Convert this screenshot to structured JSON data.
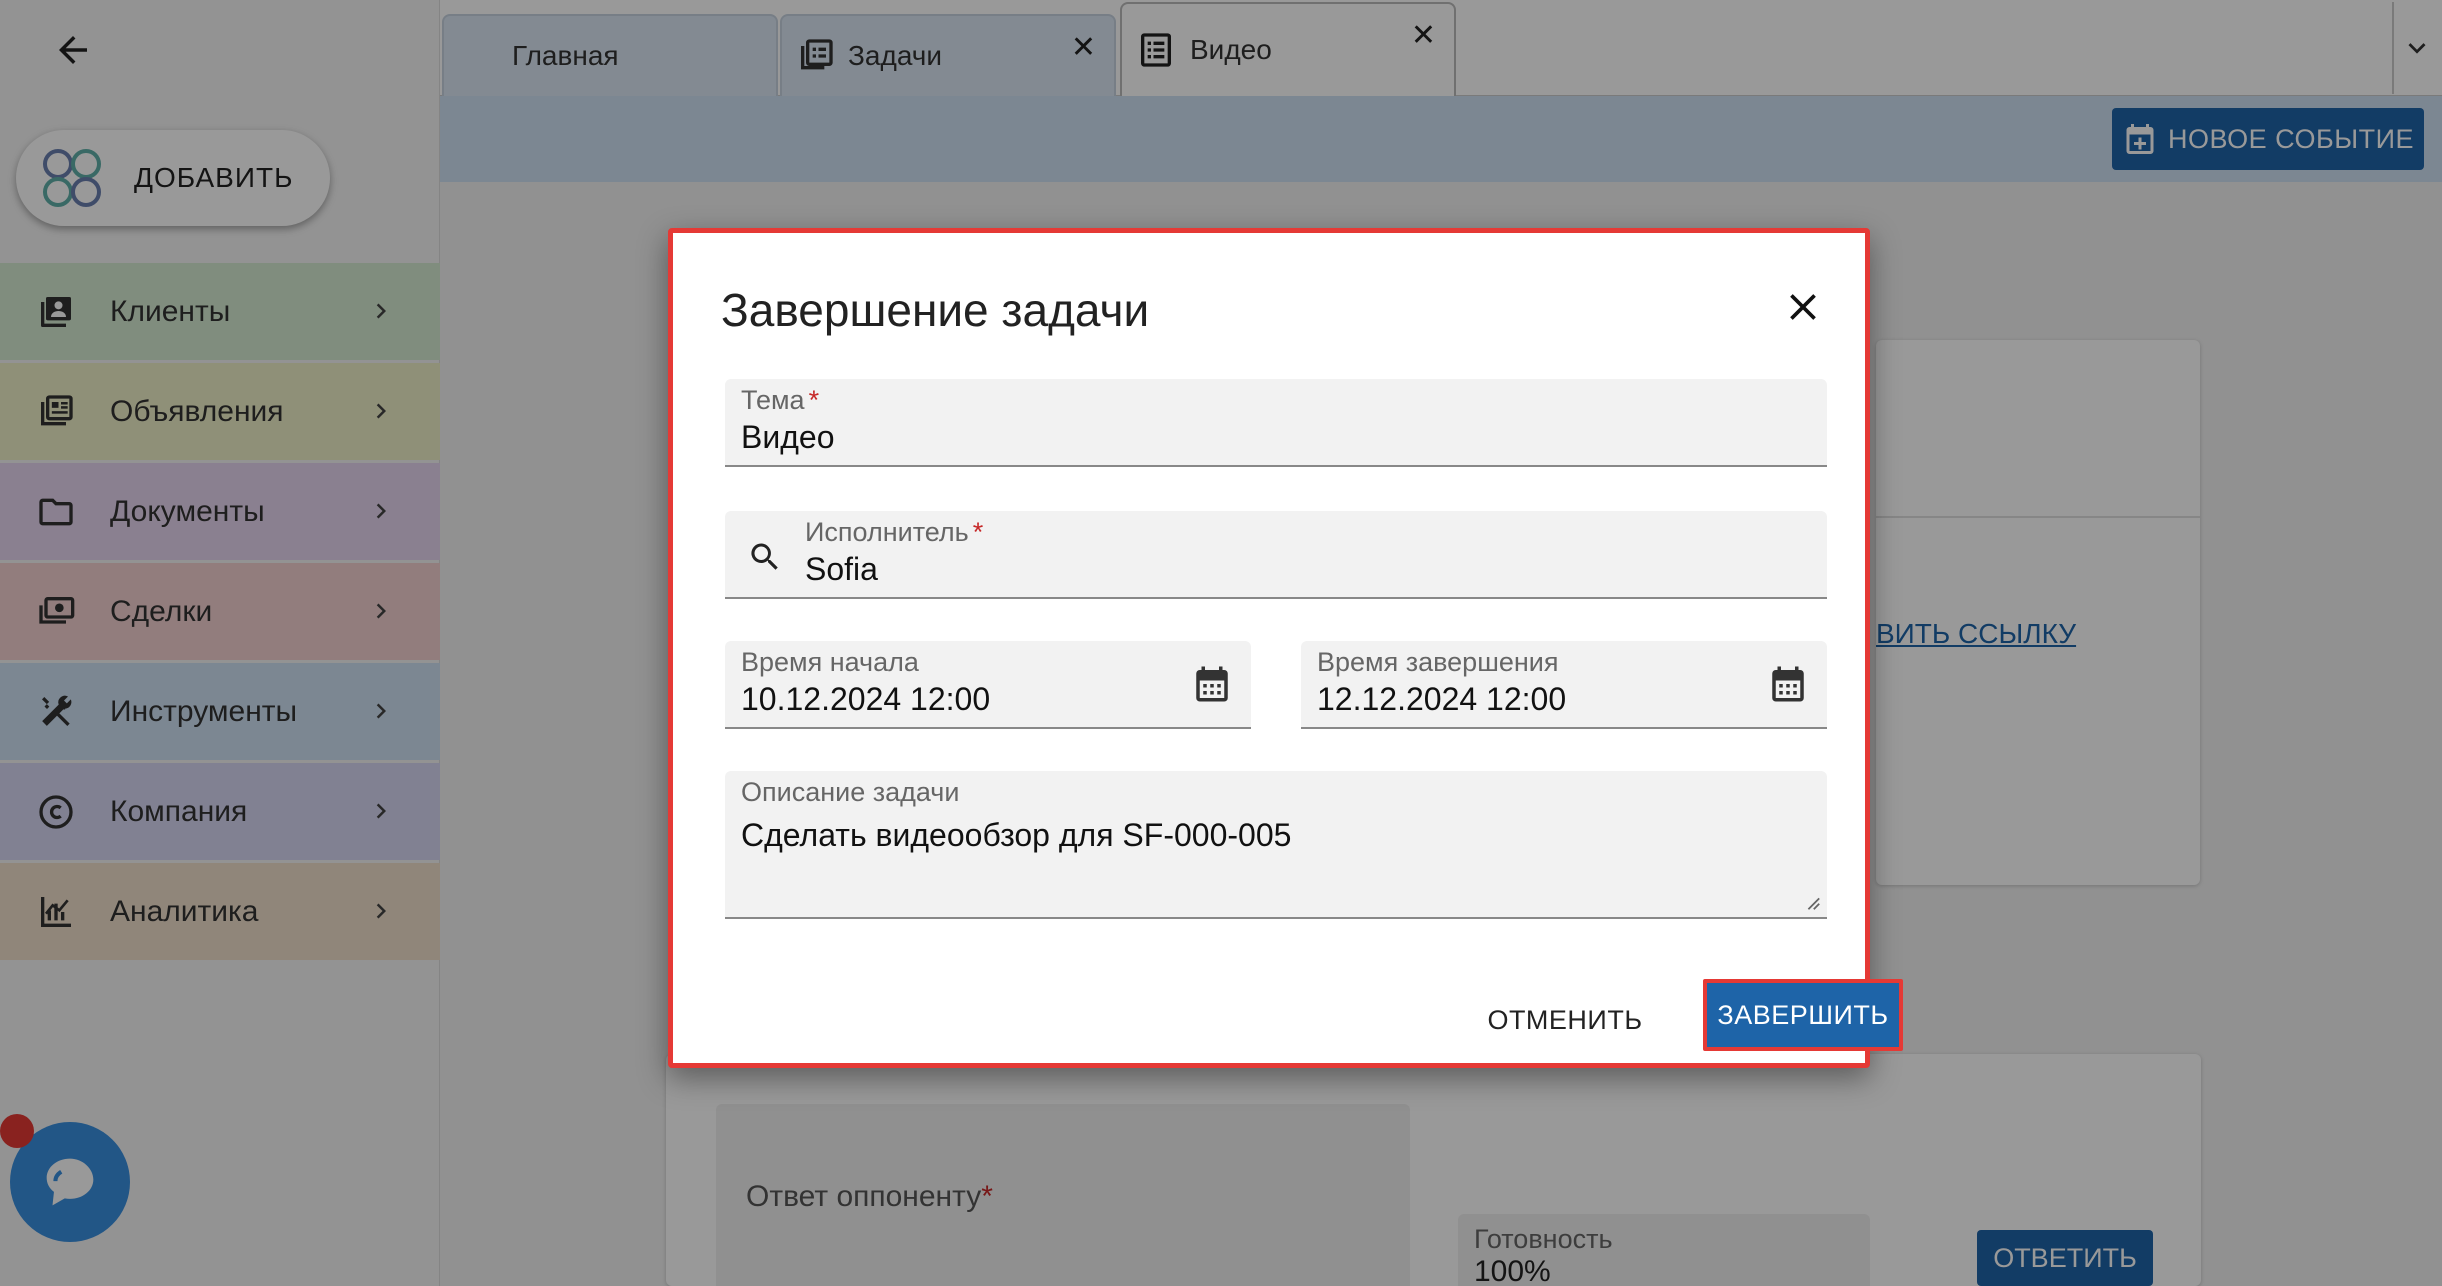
{
  "sidebar": {
    "add_label": "ДОБАВИТЬ",
    "items": [
      {
        "label": "Клиенты",
        "color": "#d6ecd3",
        "icon": "contacts-icon"
      },
      {
        "label": "Объявления",
        "color": "#eef0c8",
        "icon": "listings-icon"
      },
      {
        "label": "Документы",
        "color": "#e6d6f0",
        "icon": "folder-icon"
      },
      {
        "label": "Сделки",
        "color": "#f3d1d1",
        "icon": "money-icon"
      },
      {
        "label": "Инструменты",
        "color": "#cfe1f3",
        "icon": "tools-icon"
      },
      {
        "label": "Компания",
        "color": "#d8d8f3",
        "icon": "copyright-icon"
      },
      {
        "label": "Аналитика",
        "color": "#f1e0cc",
        "icon": "analytics-icon"
      }
    ]
  },
  "tabs": {
    "home": "Главная",
    "tasks": "Задачи",
    "video": "Видео"
  },
  "toolbar": {
    "new_event": "НОВОЕ СОБЫТИЕ"
  },
  "background": {
    "link_text": "ВИТЬ ССЫЛКУ",
    "reply_label": "Ответ оппоненту",
    "ready_label": "Готовность",
    "ready_value": "100%",
    "reply_button": "ОТВЕТИТЬ"
  },
  "dialog": {
    "title": "Завершение задачи",
    "topic": {
      "label": "Тема",
      "value": "Видео"
    },
    "executor": {
      "label": "Исполнитель",
      "value": "Sofia"
    },
    "start": {
      "label": "Время начала",
      "value": "10.12.2024 12:00"
    },
    "end": {
      "label": "Время завершения",
      "value": "12.12.2024 12:00"
    },
    "description": {
      "label": "Описание задачи",
      "value": "Сделать видеообзор для SF-000-005"
    },
    "cancel": "ОТМЕНИТЬ",
    "finish": "ЗАВЕРШИТЬ"
  },
  "colors": {
    "accent": "#1e64a8",
    "highlight": "#e53935",
    "required": "#c62828"
  }
}
